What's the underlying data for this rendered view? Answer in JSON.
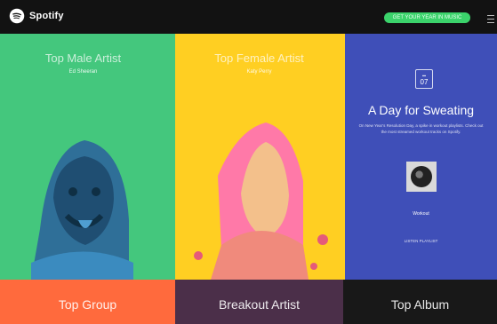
{
  "header": {
    "brand": "Spotify",
    "cta_label": "GET YOUR YEAR IN MUSIC"
  },
  "panels": [
    {
      "title": "Top Male Artist",
      "name": "Ed Sheeran",
      "subtitle": "",
      "color": "#44c77d"
    },
    {
      "title": "Top Female Artist",
      "name": "Katy Perry",
      "subtitle": "",
      "color": "#ffcf22"
    },
    {
      "title": "A Day for Sweating",
      "calendar_day": "07",
      "description": "On New Year’s Resolution Day, a spike in workout playlists. Check out the most streamed workout tracks on Spotify.",
      "track": "Workout",
      "track_sub": "",
      "cta": "LISTEN PLAYLIST",
      "color": "#3f4fb8"
    }
  ],
  "bottom": [
    {
      "title": "Top Group",
      "subtitle": "",
      "color": "#ff6a3d"
    },
    {
      "title": "Breakout Artist",
      "subtitle": "",
      "color": "#4b2f49"
    },
    {
      "title": "Top Album",
      "subtitle": "",
      "color": "#181818"
    }
  ]
}
